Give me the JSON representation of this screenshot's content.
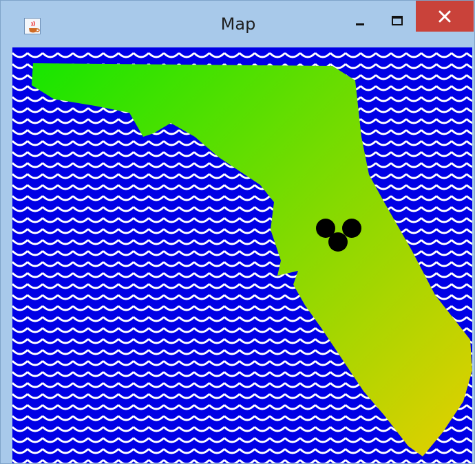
{
  "window": {
    "title": "Map",
    "icon": "java-cup-icon"
  },
  "controls": {
    "minimize": "minimize-icon",
    "maximize": "maximize-icon",
    "close": "close-icon"
  },
  "map": {
    "colors": {
      "water": "#0000e6",
      "wave": "#ffffff",
      "land_top": "#17e600",
      "land_bottom": "#dcd000",
      "marker": "#000000"
    },
    "markers_count": 3
  }
}
